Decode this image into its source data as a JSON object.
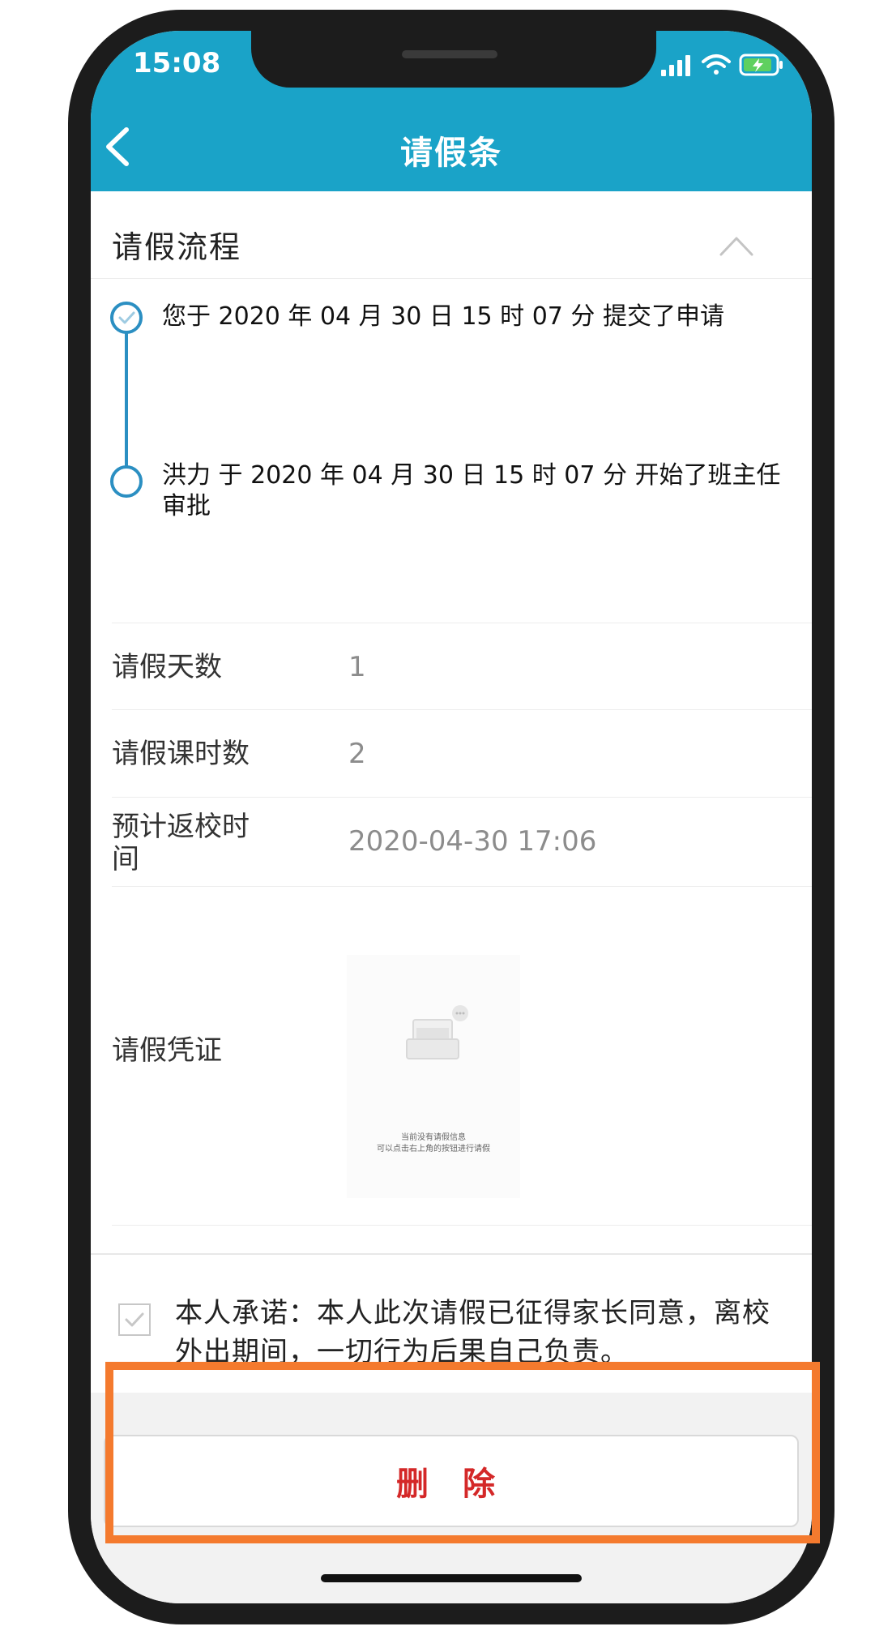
{
  "status_bar": {
    "time": "15:08"
  },
  "header": {
    "title": "请假条"
  },
  "process": {
    "title": "请假流程",
    "steps": [
      {
        "text": "您于 2020 年 04 月 30 日 15 时 07 分 提交了申请"
      },
      {
        "text": "洪力 于 2020 年 04 月 30 日 15 时 07 分 开始了班主任审批"
      }
    ]
  },
  "details": {
    "days": {
      "label": "请假天数",
      "value": "1"
    },
    "class_hours": {
      "label": "请假课时数",
      "value": "2"
    },
    "return_time": {
      "label": "预计返校时间",
      "value": "2020-04-30 17:06"
    },
    "evidence": {
      "label": "请假凭证",
      "empty_line1": "当前没有请假信息",
      "empty_line2": "可以点击右上角的按钮进行请假"
    }
  },
  "pledge": {
    "text": "本人承诺：本人此次请假已征得家长同意，离校外出期间，一切行为后果自己负责。",
    "checked": true
  },
  "actions": {
    "delete_label": "删 除"
  },
  "colors": {
    "header": "#1aa3c8",
    "timeline": "#2b8fc2",
    "delete_text": "#d42828",
    "highlight": "#f47a2e"
  }
}
